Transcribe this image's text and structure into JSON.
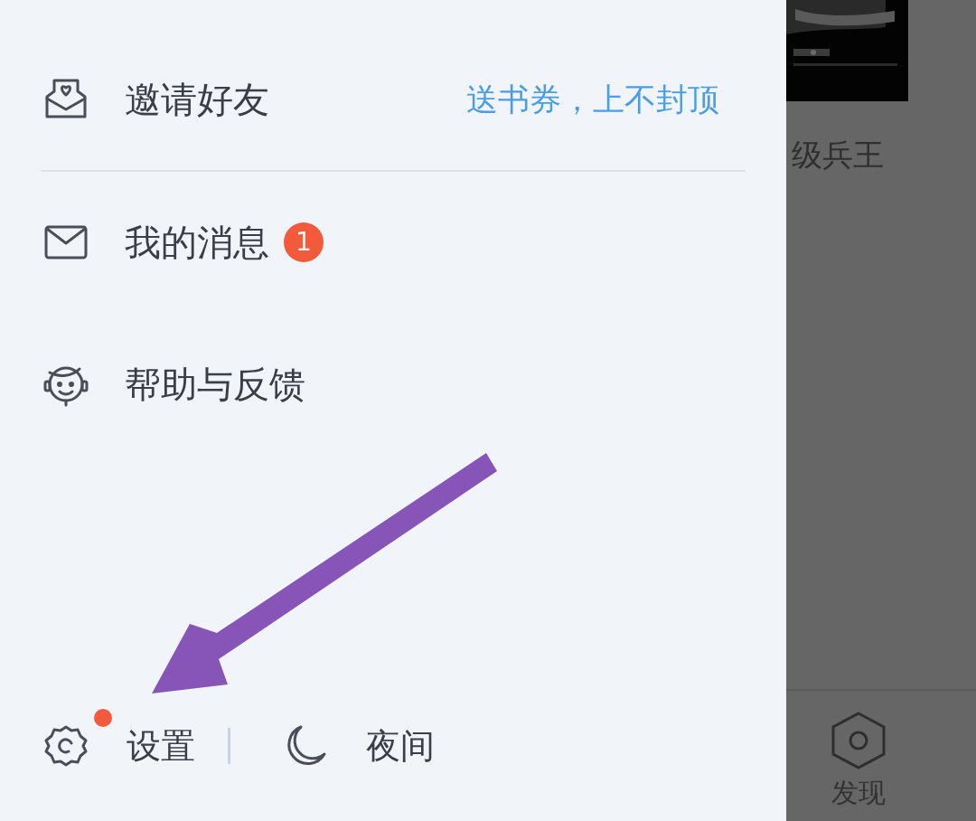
{
  "drawer": {
    "menu_items": [
      {
        "kind": "invite",
        "label": "邀请好友",
        "promo": "送书券，上不封顶"
      },
      {
        "kind": "messages",
        "label": "我的消息",
        "badge": "1"
      },
      {
        "kind": "help",
        "label": "帮助与反馈"
      }
    ],
    "footer": [
      {
        "kind": "settings",
        "label": "设置",
        "unread": true
      },
      {
        "kind": "night",
        "label": "夜间",
        "unread": false
      }
    ]
  },
  "background": {
    "book_title": "级兵王",
    "nav_label": "发现"
  }
}
